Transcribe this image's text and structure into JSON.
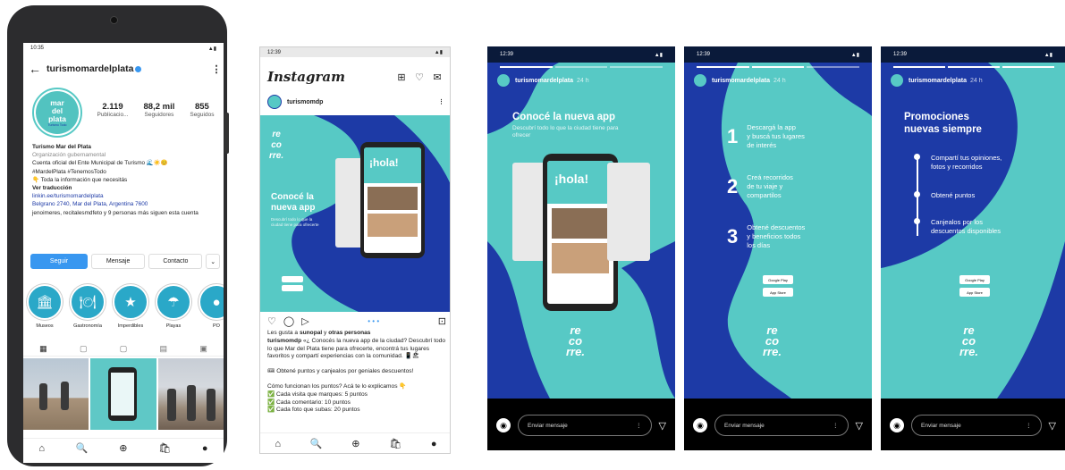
{
  "profile": {
    "time": "10:35",
    "signal": "▲▮",
    "handle": "turismomardelplata",
    "avatar_text": [
      "mar",
      "del",
      "plata"
    ],
    "avatar_sub": "Turismo Todo",
    "stats": [
      {
        "value": "2.119",
        "label": "Publicacio..."
      },
      {
        "value": "88,2 mil",
        "label": "Seguidores"
      },
      {
        "value": "855",
        "label": "Seguidos"
      }
    ],
    "name": "Turismo Mar del Plata",
    "category": "Organización gubernamental",
    "bio_lines": [
      "Cuenta oficial del Ente Municipal de Turismo 🌊☀️😊",
      "#MardelPlata #TenemosTodo",
      "👇 Toda la información que necesitás"
    ],
    "translate": "Ver traducción",
    "link": "linkin.ee/turismomardelplata",
    "address": "Belgrano 2740, Mar del Plata, Argentina 7600",
    "followed_by": "jenoimeres, recitalesmdfeto y 9 personas más siguen esta cuenta",
    "buttons": {
      "follow": "Seguir",
      "message": "Mensaje",
      "contact": "Contacto",
      "more": "⌄"
    },
    "highlights": [
      {
        "label": "Museos",
        "icon": "🏛"
      },
      {
        "label": "Gastronomía",
        "icon": "🍽"
      },
      {
        "label": "Imperdibles",
        "icon": "★"
      },
      {
        "label": "Playas",
        "icon": "☂"
      },
      {
        "label": "PO",
        "icon": "●"
      }
    ],
    "grid_tabs": [
      "▦",
      "▢",
      "▢",
      "▤",
      "▣"
    ],
    "nav": [
      "⌂",
      "🔍",
      "⊕",
      "🛍",
      "●"
    ]
  },
  "feed": {
    "time": "12:39",
    "signal": "▲▮",
    "logo": "Instagram",
    "top_icons": [
      "⊞",
      "♡",
      "✉"
    ],
    "post_user": "turismomdp",
    "post_menu": "⋮",
    "app_title": [
      "Conocé la",
      "nueva app"
    ],
    "app_sub": "Descubrí todo lo que la ciudad tiene para ofrecerte",
    "recorre": [
      "re",
      "co",
      "rre."
    ],
    "hola": "¡hola!",
    "actions": [
      "♡",
      "◯",
      "▷",
      "• • •",
      "⊡"
    ],
    "likes_prefix": "Les gusta a ",
    "likes_users": "sunopal",
    "likes_mid": " y ",
    "likes_others": "otras personas",
    "caption_user": "turismomdp",
    "caption": "«¿ Conocés la nueva app de la ciudad? Descubrí todo lo que Mar del Plata tiene para ofrecerte, encontrá tus lugares favoritos y compartí experiencias con la comunidad. 📱🏖",
    "promo": "🎟 Obtené puntos y canjealos por geniales descuentos!",
    "how": "Cómo funcionan los puntos? Acá te lo explicamos 👇",
    "p1": "✅ Cada visita que marques: 5 puntos",
    "p2": "✅ Cada comentario: 10 puntos",
    "p3": "✅ Cada foto que subas: 20 puntos",
    "nav": [
      "⌂",
      "🔍",
      "⊕",
      "🛍",
      "●"
    ]
  },
  "stories": [
    {
      "time": "12:39",
      "signal": "▲▮",
      "user": "turismomardelplata",
      "ago": "24 h",
      "title": "Conocé la nueva app",
      "subtitle": "Descubrí todo lo que la ciudad tiene para ofrecer",
      "hola": "¡hola!",
      "recorre": [
        "re",
        "co",
        "rre."
      ],
      "message_placeholder": "Enviar mensaje",
      "kebab": "⋮",
      "send": "▽",
      "camera": "◉"
    },
    {
      "time": "12:39",
      "signal": "▲▮",
      "user": "turismomardelplata",
      "ago": "24 h",
      "steps": [
        {
          "num": "1",
          "text": [
            "Descargá la app",
            "y buscá tus lugares",
            "de interés"
          ]
        },
        {
          "num": "2",
          "text": [
            "Creá recorridos",
            "de tu viaje y",
            "compartilos"
          ]
        },
        {
          "num": "3",
          "text": [
            "Obtené descuentos",
            "y beneficios todos",
            "los días"
          ]
        }
      ],
      "store1": "Google Play",
      "store2": "App Store",
      "recorre": [
        "re",
        "co",
        "rre."
      ],
      "message_placeholder": "Enviar mensaje",
      "kebab": "⋮",
      "send": "▽",
      "camera": "◉"
    },
    {
      "time": "12:39",
      "signal": "▲▮",
      "user": "turismomardelplata",
      "ago": "24 h",
      "title": [
        "Promociones",
        "nuevas siempre"
      ],
      "items": [
        [
          "Compartí tus opiniones,",
          "fotos y recorridos"
        ],
        [
          "Obtené puntos"
        ],
        [
          "Canjealos por los",
          "descuentos disponibles"
        ]
      ],
      "store1": "Google Play",
      "store2": "App Store",
      "recorre": [
        "re",
        "co",
        "rre."
      ],
      "message_placeholder": "Enviar mensaje",
      "kebab": "⋮",
      "send": "▽",
      "camera": "◉"
    }
  ],
  "colors": {
    "teal": "#57c9c5",
    "navy": "#1d3aa6",
    "ig_blue": "#3897f0"
  }
}
